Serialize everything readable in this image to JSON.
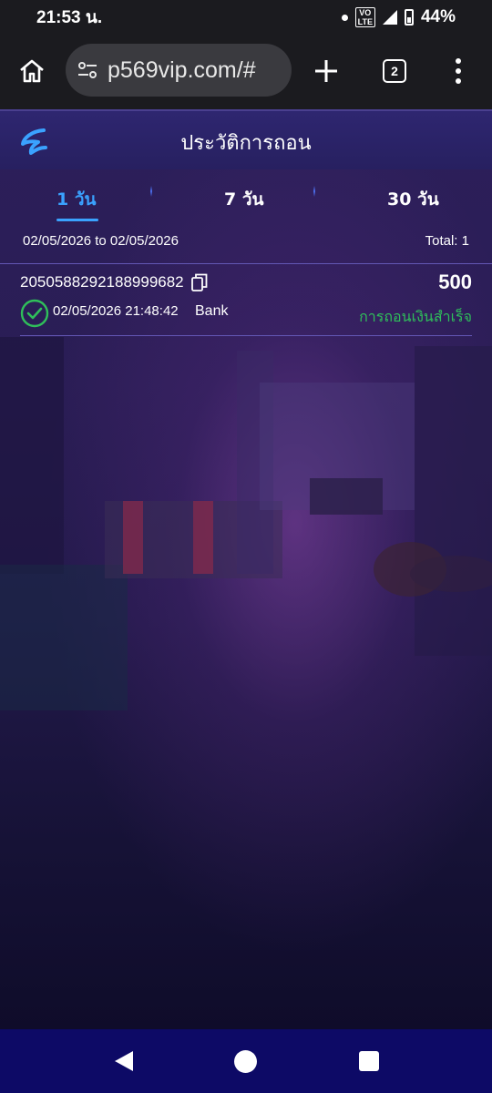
{
  "status_bar": {
    "time": "21:53 น.",
    "volte_top": "VO",
    "volte_bottom": "LTE",
    "battery": "44%"
  },
  "browser": {
    "url": "p569vip.com/#",
    "tab_count": "2"
  },
  "app": {
    "title": "ประวัติการถอน",
    "tabs": [
      {
        "label": "1 วัน",
        "active": true
      },
      {
        "label": "7 วัน",
        "active": false
      },
      {
        "label": "30 วัน",
        "active": false
      }
    ],
    "date_range": "02/05/2026 to 02/05/2026",
    "total": "Total: 1",
    "records": [
      {
        "id": "2050588292188999682",
        "amount": "500",
        "datetime": "02/05/2026 21:48:42",
        "method": "Bank",
        "status": "การถอนเงินสำเร็จ"
      }
    ]
  },
  "colors": {
    "accent": "#3aa2ff",
    "success": "#2fbf5a",
    "nav_bar": "#0d0a66"
  }
}
